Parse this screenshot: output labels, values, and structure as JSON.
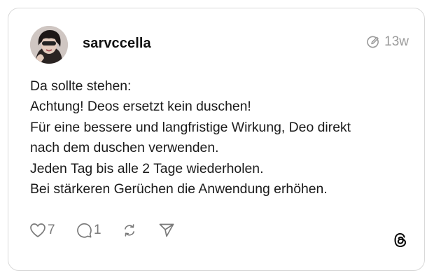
{
  "post": {
    "username": "sarvccella",
    "time_ago": "13w",
    "lines": [
      "Da sollte stehen:",
      "Achtung! Deos ersetzt kein duschen!",
      "Für eine bessere und langfristige Wirkung, Deo direkt",
      "nach dem duschen verwenden.",
      "Jeden Tag bis alle 2 Tage wiederholen.",
      "Bei stärkeren Gerüchen die Anwendung erhöhen."
    ],
    "like_count": "7",
    "reply_count": "1"
  },
  "icons": {
    "edited": "edited-pencil-circle-icon",
    "like": "heart-outline-icon",
    "reply": "speech-bubble-icon",
    "repost": "repost-arrows-icon",
    "share": "paper-plane-icon",
    "logo": "threads-logo-icon"
  },
  "colors": {
    "text": "#1a1a1a",
    "muted": "#9a9a9a",
    "action": "#7a7a7a",
    "border": "#d9d9d9"
  }
}
